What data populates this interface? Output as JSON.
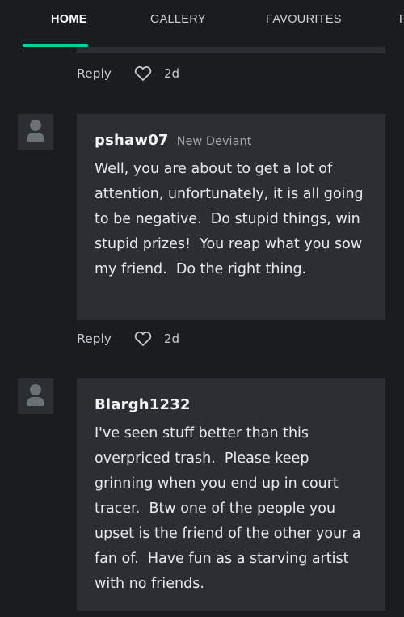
{
  "tabs": [
    {
      "label": "HOME",
      "active": true
    },
    {
      "label": "GALLERY",
      "active": false
    },
    {
      "label": "FAVOURITES",
      "active": false
    },
    {
      "label": "P",
      "active": false
    }
  ],
  "accent_color": "#00d29b",
  "comments": [
    {
      "actions": {
        "reply_label": "Reply",
        "time": "2d"
      }
    },
    {
      "username": "pshaw07",
      "role": "New Deviant",
      "text": "Well, you are about to get a lot of attention, unfortunately, it is all going to be negative.  Do stupid things, win stupid prizes!  You reap what you sow my friend.  Do the right thing.",
      "actions": {
        "reply_label": "Reply",
        "time": "2d"
      }
    },
    {
      "username": "Blargh1232",
      "role": "",
      "text": "I've seen stuff better than this overpriced trash.  Please keep grinning when you end up in court tracer.  Btw one of the people you upset is the friend of the other your a fan of.  Have fun as a starving artist with no friends."
    }
  ]
}
